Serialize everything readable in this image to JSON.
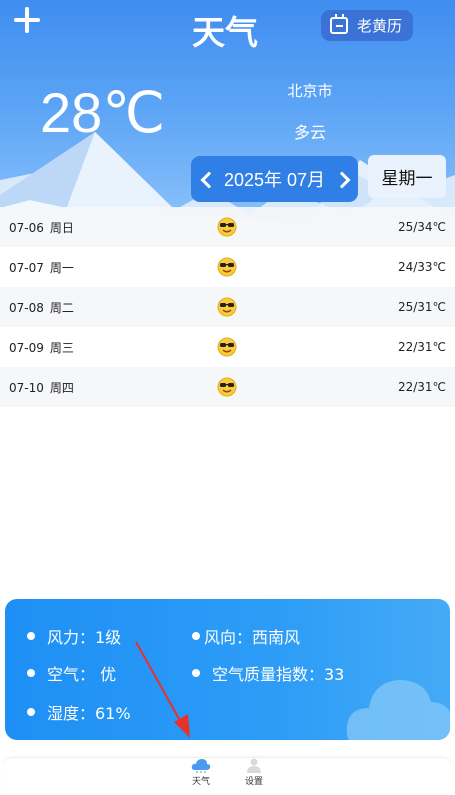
{
  "header": {
    "title": "天气",
    "almanac_label": "老黄历",
    "temperature": "28℃",
    "city": "北京市",
    "condition": "多云",
    "month": "2025年 07月",
    "weekday": "星期一"
  },
  "forecast": [
    {
      "date": "07-06",
      "weekday": "周日",
      "icon": "sunglasses-sun-icon",
      "range": "25/34℃"
    },
    {
      "date": "07-07",
      "weekday": "周一",
      "icon": "sunglasses-sun-icon",
      "range": "24/33℃"
    },
    {
      "date": "07-08",
      "weekday": "周二",
      "icon": "sunglasses-sun-icon",
      "range": "25/31℃"
    },
    {
      "date": "07-09",
      "weekday": "周三",
      "icon": "sunglasses-sun-icon",
      "range": "22/31℃"
    },
    {
      "date": "07-10",
      "weekday": "周四",
      "icon": "sunglasses-sun-icon",
      "range": "22/31℃"
    }
  ],
  "details": {
    "wind_power": "风力：1级",
    "wind_direction": "风向：西南风",
    "air": "空气：  优",
    "aqi": "空气质量指数：33",
    "humidity": "湿度：61%"
  },
  "nav": {
    "weather_label": "天气",
    "settings_label": "设置"
  },
  "colors": {
    "accent": "#2f7fe6",
    "card": "#1e90f5",
    "annotation_arrow": "#e8312a"
  }
}
